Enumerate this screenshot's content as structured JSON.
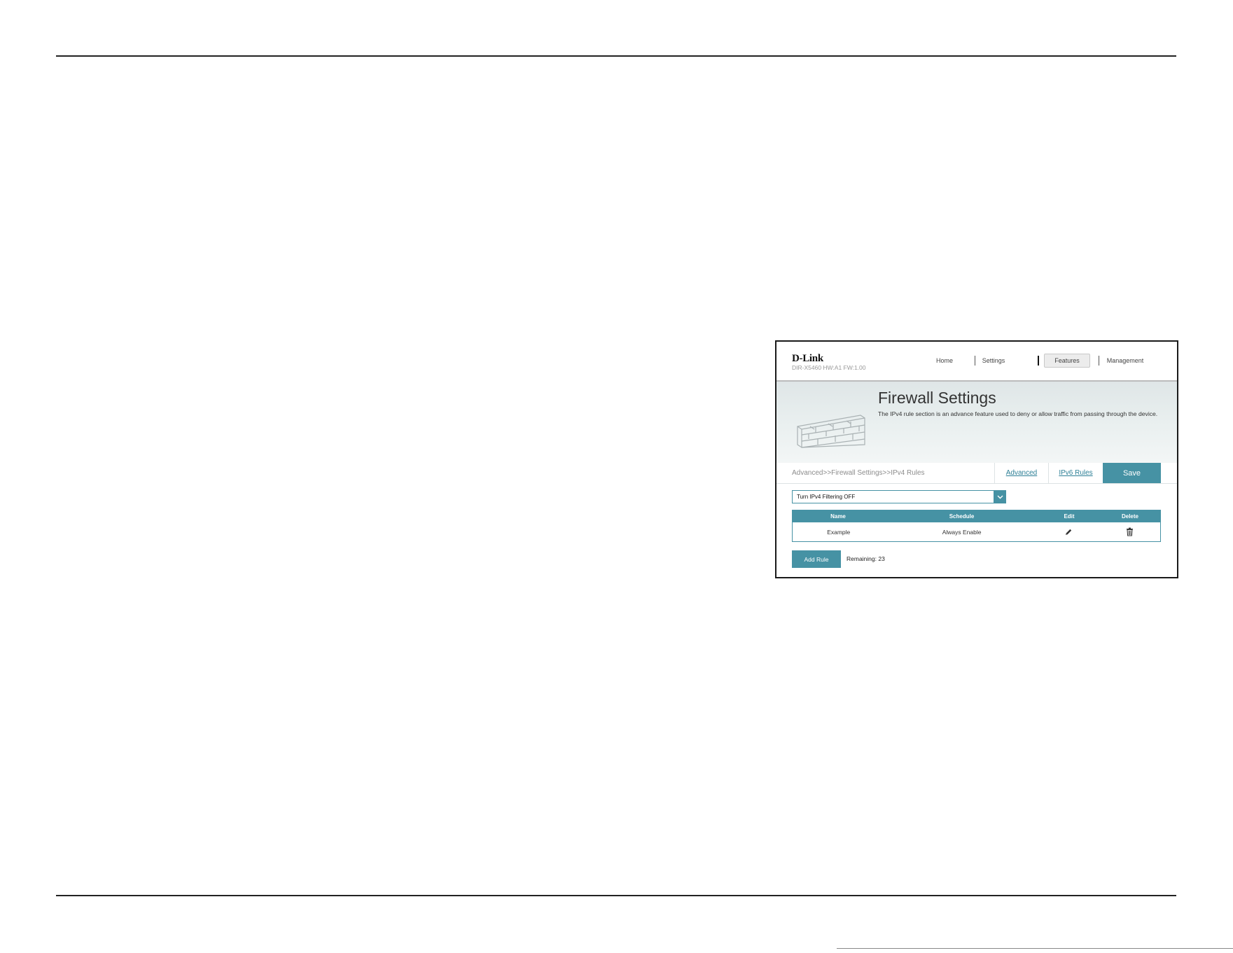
{
  "header": {
    "logo": "D-Link",
    "model": "DIR-X5460 HW:A1 FW:1.00",
    "nav": [
      "Home",
      "Settings",
      "Features",
      "Management"
    ]
  },
  "banner": {
    "title": "Firewall Settings",
    "description": "The IPv4 rule section is an advance feature used to deny or allow traffic from passing through the device."
  },
  "crumbbar": {
    "breadcrumb": "Advanced>>Firewall Settings>>IPv4 Rules",
    "advanced_link": "Advanced",
    "ipv6_link": "IPv6 Rules",
    "save_label": "Save"
  },
  "filter": {
    "selected": "Turn IPv4 Filtering OFF"
  },
  "table": {
    "headers": [
      "Name",
      "Schedule",
      "Edit",
      "Delete"
    ],
    "rows": [
      {
        "name": "Example",
        "schedule": "Always Enable",
        "edit_icon": "pencil-icon",
        "delete_icon": "trash-icon"
      }
    ]
  },
  "footer": {
    "add_rule_label": "Add Rule",
    "remaining": "Remaining: 23"
  },
  "colors": {
    "accent": "#4692a4",
    "link": "#2d7f96"
  }
}
